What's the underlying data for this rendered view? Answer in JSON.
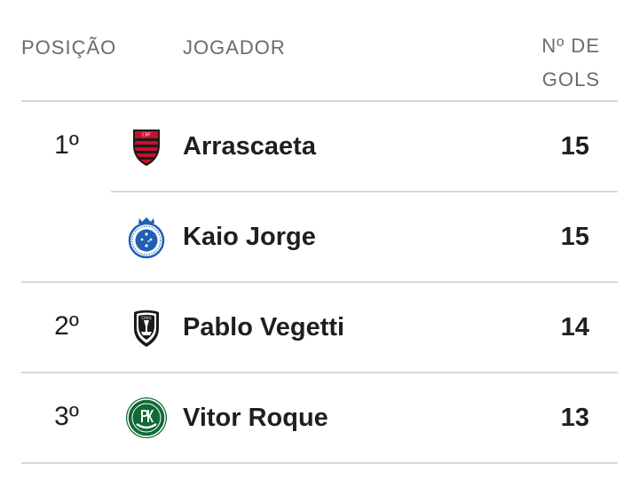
{
  "header": {
    "position": "POSIÇÃO",
    "player": "JOGADOR",
    "goals_line1": "Nº DE",
    "goals_line2": "GOLS"
  },
  "rows": [
    {
      "position": "1º",
      "team_icon": "flamengo-crest-icon",
      "player": "Arrascaeta",
      "goals": "15"
    },
    {
      "position": "",
      "team_icon": "cruzeiro-crest-icon",
      "player": "Kaio Jorge",
      "goals": "15"
    },
    {
      "position": "2º",
      "team_icon": "vasco-crest-icon",
      "player": "Pablo Vegetti",
      "goals": "14"
    },
    {
      "position": "3º",
      "team_icon": "palmeiras-crest-icon",
      "player": "Vitor Roque",
      "goals": "13"
    }
  ],
  "colors": {
    "text": "#1f1f1f",
    "header_text": "#6b6b6b",
    "divider": "#d8d8d8",
    "flamengo_red": "#c8102e",
    "cruzeiro_blue": "#1f5fb5",
    "palmeiras_green": "#0f6b35"
  }
}
